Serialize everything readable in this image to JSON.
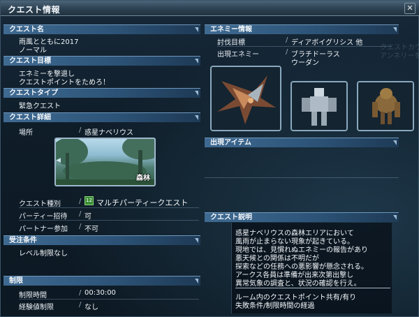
{
  "window": {
    "title": "クエスト情報",
    "close_glyph": "✕"
  },
  "left": {
    "quest_name": {
      "header": "クエスト名",
      "lines": [
        "雨風とともに2017",
        "ノーマル"
      ]
    },
    "quest_goal": {
      "header": "クエスト目標",
      "lines": [
        "エネミーを撃退し",
        "クエストポイントをためろ！"
      ]
    },
    "quest_type": {
      "header": "クエストタイプ",
      "value": "緊急クエスト"
    },
    "quest_detail": {
      "header": "クエスト詳細",
      "location_label": "場所",
      "location_value": "惑星ナベリウス",
      "area_label": "森林",
      "kind_label": "クエスト種別",
      "kind_value": "マルチパーティークエスト",
      "kind_icon": "12",
      "party_invite_label": "パーティー招待",
      "party_invite_value": "可",
      "partner_label": "パートナー参加",
      "partner_value": "不可"
    },
    "conditions": {
      "header": "受注条件",
      "value": "レベル制限なし"
    },
    "limits": {
      "header": "制限",
      "time_label": "制限時間",
      "time_value": "00:30:00",
      "exp_label": "経験値制限",
      "exp_value": "なし"
    },
    "separator": "/"
  },
  "right": {
    "enemy_info": {
      "header": "エネミー情報",
      "target_label": "討伐目標",
      "target_value": "ディアボイグリシス 他",
      "appear_label": "出現エネミー",
      "appear_values": [
        "ブラチドーラス",
        "ウーダン"
      ],
      "enemies": [
        "ディアボイグリシス",
        "ブラチドーラス",
        "ウーダン"
      ]
    },
    "items": {
      "header": "出現アイテム"
    },
    "description": {
      "header": "クエスト説明",
      "lines": [
        "惑星ナベリウスの森林エリアにおいて",
        "風雨が止まらない現象が起きている。",
        "現地では、見慣れぬエネミーの報告があり",
        "悪天候との関係は不明だが",
        "探索などの任務への悪影響が懸念される。",
        "アークス各員は準備が出来次第出撃し",
        "異常気象の調査と、状況の確認を行え。"
      ],
      "footer_lines": [
        "ルーム内のクエストポイント共有/有り",
        "失敗条件/制限時間の経過"
      ]
    },
    "ghost_text": [
      "クエストカウ",
      "アンネリーを"
    ]
  },
  "colors": {
    "header_blue": "#3f6a92",
    "panel_bg": "#0f1d29",
    "accent_green": "#3b8f35"
  }
}
